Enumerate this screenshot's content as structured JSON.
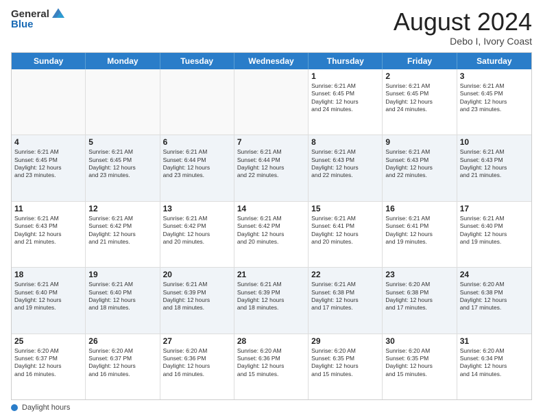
{
  "logo": {
    "general": "General",
    "blue": "Blue"
  },
  "title": {
    "month_year": "August 2024",
    "location": "Debo I, Ivory Coast"
  },
  "headers": [
    "Sunday",
    "Monday",
    "Tuesday",
    "Wednesday",
    "Thursday",
    "Friday",
    "Saturday"
  ],
  "weeks": [
    [
      {
        "day": "",
        "info": ""
      },
      {
        "day": "",
        "info": ""
      },
      {
        "day": "",
        "info": ""
      },
      {
        "day": "",
        "info": ""
      },
      {
        "day": "1",
        "info": "Sunrise: 6:21 AM\nSunset: 6:45 PM\nDaylight: 12 hours\nand 24 minutes."
      },
      {
        "day": "2",
        "info": "Sunrise: 6:21 AM\nSunset: 6:45 PM\nDaylight: 12 hours\nand 24 minutes."
      },
      {
        "day": "3",
        "info": "Sunrise: 6:21 AM\nSunset: 6:45 PM\nDaylight: 12 hours\nand 23 minutes."
      }
    ],
    [
      {
        "day": "4",
        "info": "Sunrise: 6:21 AM\nSunset: 6:45 PM\nDaylight: 12 hours\nand 23 minutes."
      },
      {
        "day": "5",
        "info": "Sunrise: 6:21 AM\nSunset: 6:45 PM\nDaylight: 12 hours\nand 23 minutes."
      },
      {
        "day": "6",
        "info": "Sunrise: 6:21 AM\nSunset: 6:44 PM\nDaylight: 12 hours\nand 23 minutes."
      },
      {
        "day": "7",
        "info": "Sunrise: 6:21 AM\nSunset: 6:44 PM\nDaylight: 12 hours\nand 22 minutes."
      },
      {
        "day": "8",
        "info": "Sunrise: 6:21 AM\nSunset: 6:43 PM\nDaylight: 12 hours\nand 22 minutes."
      },
      {
        "day": "9",
        "info": "Sunrise: 6:21 AM\nSunset: 6:43 PM\nDaylight: 12 hours\nand 22 minutes."
      },
      {
        "day": "10",
        "info": "Sunrise: 6:21 AM\nSunset: 6:43 PM\nDaylight: 12 hours\nand 21 minutes."
      }
    ],
    [
      {
        "day": "11",
        "info": "Sunrise: 6:21 AM\nSunset: 6:43 PM\nDaylight: 12 hours\nand 21 minutes."
      },
      {
        "day": "12",
        "info": "Sunrise: 6:21 AM\nSunset: 6:42 PM\nDaylight: 12 hours\nand 21 minutes."
      },
      {
        "day": "13",
        "info": "Sunrise: 6:21 AM\nSunset: 6:42 PM\nDaylight: 12 hours\nand 20 minutes."
      },
      {
        "day": "14",
        "info": "Sunrise: 6:21 AM\nSunset: 6:42 PM\nDaylight: 12 hours\nand 20 minutes."
      },
      {
        "day": "15",
        "info": "Sunrise: 6:21 AM\nSunset: 6:41 PM\nDaylight: 12 hours\nand 20 minutes."
      },
      {
        "day": "16",
        "info": "Sunrise: 6:21 AM\nSunset: 6:41 PM\nDaylight: 12 hours\nand 19 minutes."
      },
      {
        "day": "17",
        "info": "Sunrise: 6:21 AM\nSunset: 6:40 PM\nDaylight: 12 hours\nand 19 minutes."
      }
    ],
    [
      {
        "day": "18",
        "info": "Sunrise: 6:21 AM\nSunset: 6:40 PM\nDaylight: 12 hours\nand 19 minutes."
      },
      {
        "day": "19",
        "info": "Sunrise: 6:21 AM\nSunset: 6:40 PM\nDaylight: 12 hours\nand 18 minutes."
      },
      {
        "day": "20",
        "info": "Sunrise: 6:21 AM\nSunset: 6:39 PM\nDaylight: 12 hours\nand 18 minutes."
      },
      {
        "day": "21",
        "info": "Sunrise: 6:21 AM\nSunset: 6:39 PM\nDaylight: 12 hours\nand 18 minutes."
      },
      {
        "day": "22",
        "info": "Sunrise: 6:21 AM\nSunset: 6:38 PM\nDaylight: 12 hours\nand 17 minutes."
      },
      {
        "day": "23",
        "info": "Sunrise: 6:20 AM\nSunset: 6:38 PM\nDaylight: 12 hours\nand 17 minutes."
      },
      {
        "day": "24",
        "info": "Sunrise: 6:20 AM\nSunset: 6:38 PM\nDaylight: 12 hours\nand 17 minutes."
      }
    ],
    [
      {
        "day": "25",
        "info": "Sunrise: 6:20 AM\nSunset: 6:37 PM\nDaylight: 12 hours\nand 16 minutes."
      },
      {
        "day": "26",
        "info": "Sunrise: 6:20 AM\nSunset: 6:37 PM\nDaylight: 12 hours\nand 16 minutes."
      },
      {
        "day": "27",
        "info": "Sunrise: 6:20 AM\nSunset: 6:36 PM\nDaylight: 12 hours\nand 16 minutes."
      },
      {
        "day": "28",
        "info": "Sunrise: 6:20 AM\nSunset: 6:36 PM\nDaylight: 12 hours\nand 15 minutes."
      },
      {
        "day": "29",
        "info": "Sunrise: 6:20 AM\nSunset: 6:35 PM\nDaylight: 12 hours\nand 15 minutes."
      },
      {
        "day": "30",
        "info": "Sunrise: 6:20 AM\nSunset: 6:35 PM\nDaylight: 12 hours\nand 15 minutes."
      },
      {
        "day": "31",
        "info": "Sunrise: 6:20 AM\nSunset: 6:34 PM\nDaylight: 12 hours\nand 14 minutes."
      }
    ]
  ],
  "footer": {
    "label": "Daylight hours"
  }
}
